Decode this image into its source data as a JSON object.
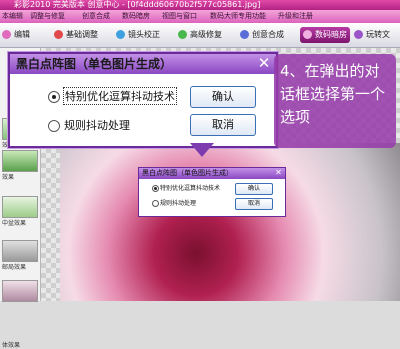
{
  "app": {
    "title": "彩影2010  完美版本  创意中心 - [0f4ddd60670b2f577c05861.jpg]"
  },
  "menu": [
    "本编辑",
    "调整与修复",
    "创意合成",
    "数码暗房",
    "视图与窗口",
    "数码大师专用功能",
    "升级和注册"
  ],
  "toolbar": [
    {
      "label": "编辑",
      "icon": "edit-icon"
    },
    {
      "label": "基础调整",
      "icon": "adjust-icon"
    },
    {
      "label": "镜头校正",
      "icon": "lens-icon"
    },
    {
      "label": "高级修复",
      "icon": "repair-icon"
    },
    {
      "label": "创意合成",
      "icon": "compose-icon"
    },
    {
      "label": "数码暗房",
      "icon": "darkroom-icon",
      "active": true
    },
    {
      "label": "玩转文",
      "icon": "text-icon"
    }
  ],
  "sidebar": {
    "labels": [
      "效果",
      "效果",
      "中盆效果",
      "邮局效果",
      "体效果"
    ]
  },
  "dialog": {
    "title": "黑白点阵图（单色图片生成）",
    "options": [
      "特别优化逗算抖动技术",
      "规则抖动处理"
    ],
    "ok": "确认",
    "cancel": "取消",
    "close": "✕"
  },
  "tip": {
    "text": "4、在弹出的对话框选择第一个选项"
  },
  "small_dialog": {
    "title": "黑白点阵图（单色图片生成）",
    "options": [
      "特别优化逗算抖动技术",
      "规则抖动处理"
    ],
    "ok": "确认",
    "cancel": "取消",
    "close": "✕"
  },
  "colors": {
    "accent": "#8a48c2",
    "title_bar": "#c32a94",
    "tip_bg": "#963caa"
  }
}
